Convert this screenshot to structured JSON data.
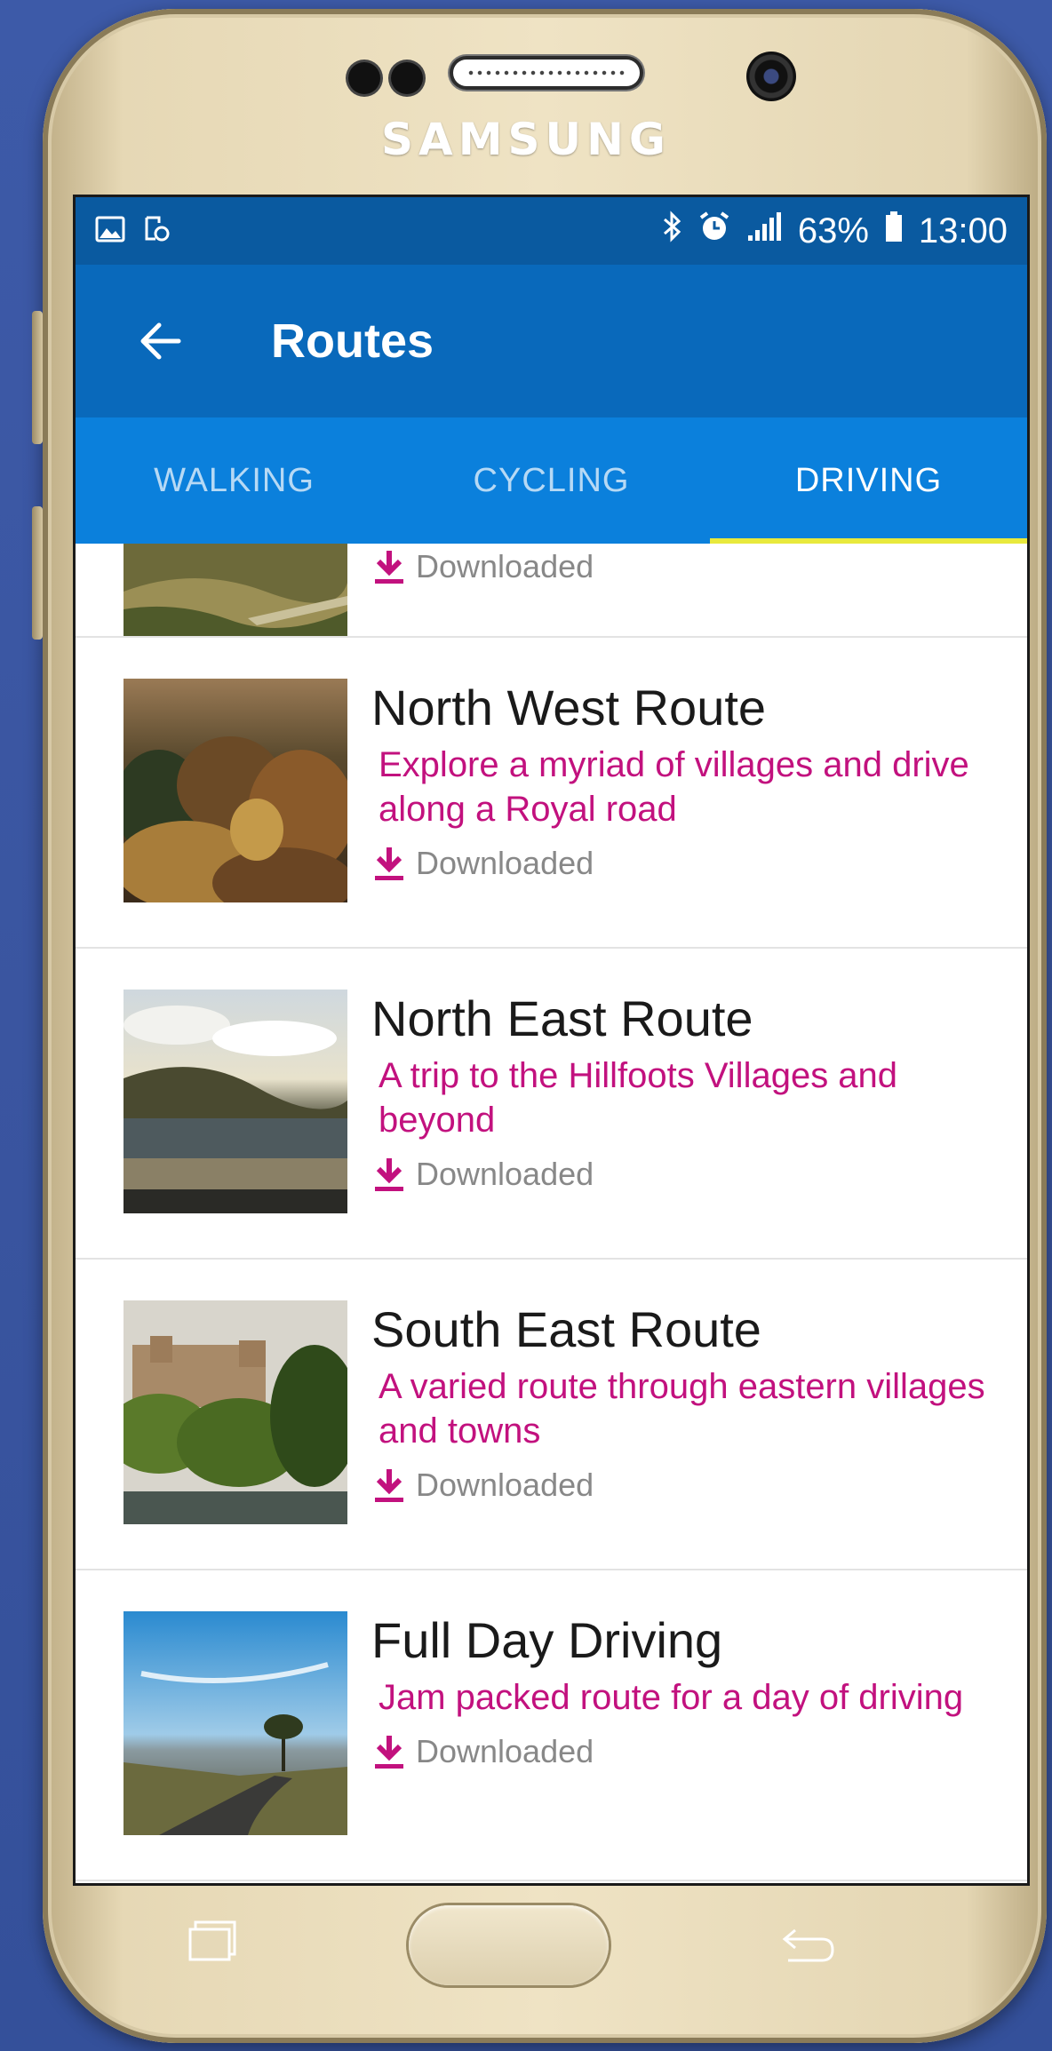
{
  "device": {
    "brand": "SAMSUNG"
  },
  "statusbar": {
    "left_icons": [
      "image-icon",
      "screenshot-icon"
    ],
    "right_icons": [
      "bluetooth-icon",
      "alarm-icon",
      "signal-icon"
    ],
    "battery": "63%",
    "time": "13:00"
  },
  "appbar": {
    "title": "Routes"
  },
  "tabs": [
    {
      "label": "WALKING",
      "active": false
    },
    {
      "label": "CYCLING",
      "active": false
    },
    {
      "label": "DRIVING",
      "active": true
    }
  ],
  "routes": [
    {
      "title": "",
      "description": "",
      "status": "Downloaded"
    },
    {
      "title": "North West Route",
      "description": "Explore a myriad of villages and drive along a Royal road",
      "status": "Downloaded"
    },
    {
      "title": "North East Route",
      "description": "A trip to the Hillfoots Villages and beyond",
      "status": "Downloaded"
    },
    {
      "title": "South East Route",
      "description": "A varied route through eastern villages and towns",
      "status": "Downloaded"
    },
    {
      "title": "Full Day Driving",
      "description": "Jam packed route for a day of driving",
      "status": "Downloaded"
    }
  ],
  "colors": {
    "statusbar": "#0a5aa0",
    "appbar": "#0969bb",
    "tabbar": "#0b80dc",
    "tab_indicator": "#e8e93d",
    "description": "#c2117e"
  }
}
